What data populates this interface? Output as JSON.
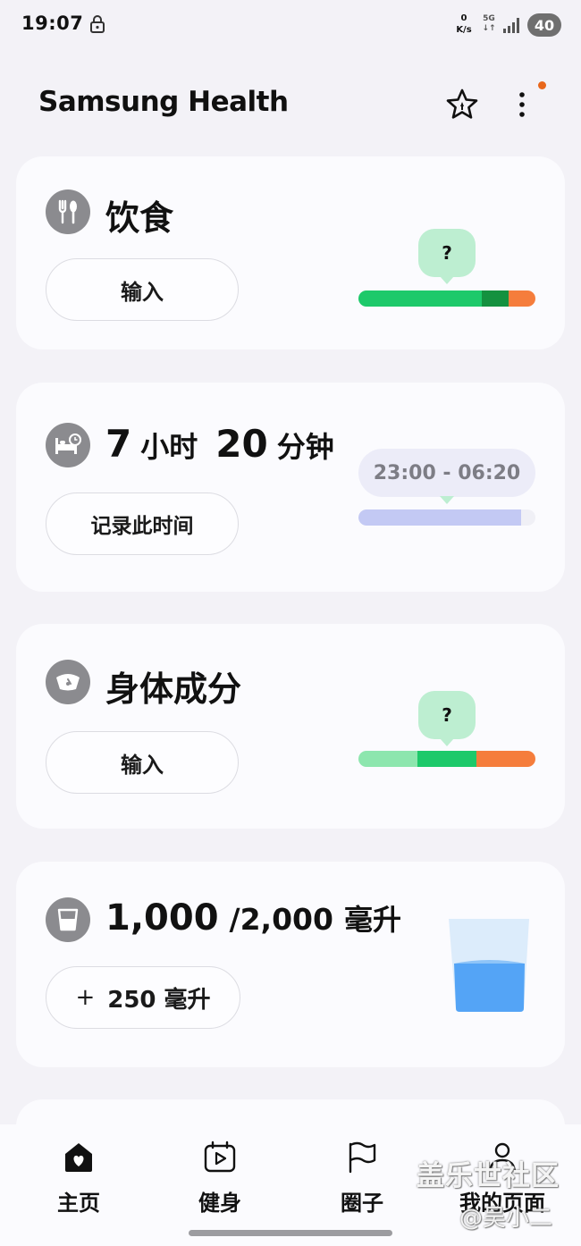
{
  "status_bar": {
    "time": "19:07",
    "net_speed_value": "0",
    "net_speed_unit": "K/s",
    "network_type": "5G",
    "battery": "40"
  },
  "header": {
    "title": "Samsung Health"
  },
  "cards": {
    "food": {
      "title": "饮食",
      "button_label": "输入",
      "bubble": "?",
      "icon": "cutlery-icon"
    },
    "sleep": {
      "hours": "7",
      "hours_unit": "小时",
      "minutes": "20",
      "minutes_unit": "分钟",
      "button_label": "记录此时间",
      "time_range": "23:00 - 06:20",
      "icon": "bed-icon",
      "progress": 0.92
    },
    "body": {
      "title": "身体成分",
      "button_label": "输入",
      "bubble": "?",
      "icon": "scale-icon"
    },
    "water": {
      "current": "1,000",
      "goal": "/2,000",
      "unit": "毫升",
      "button_plus": "+",
      "button_amount": "250 毫升",
      "icon": "cup-icon",
      "fill_fraction": 0.5
    }
  },
  "bottom_nav": {
    "items": [
      {
        "label": "主页",
        "icon": "home-icon"
      },
      {
        "label": "健身",
        "icon": "fitness-play-icon"
      },
      {
        "label": "圈子",
        "icon": "flag-icon"
      },
      {
        "label": "我的页面",
        "icon": "person-icon"
      }
    ]
  },
  "watermark": {
    "line1": "盖乐世社区",
    "line2": "@吴小二"
  },
  "colors": {
    "background": "#f3f2f7",
    "card": "#fbfbfe",
    "green": "#1dc96a",
    "dark_green": "#14913f",
    "orange": "#f57d3c",
    "light_green": "#8de6ae",
    "sleep_blue": "#c3c9f4",
    "water_blue": "#54a4f6",
    "notification": "#e8671b"
  }
}
